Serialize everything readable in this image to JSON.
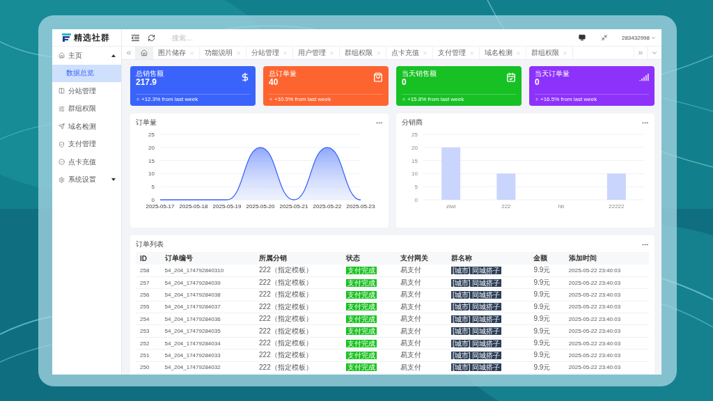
{
  "brand": {
    "name": "精选社群"
  },
  "header": {
    "search": {
      "placeholder": "搜索..."
    },
    "user": "283432998"
  },
  "sidebar": {
    "items": [
      {
        "label": "主页",
        "selected": false,
        "expanded": true,
        "children": [
          {
            "label": "数据总览",
            "selected": true
          }
        ]
      },
      {
        "label": "分站管理",
        "selected": false
      },
      {
        "label": "群组权限",
        "selected": false
      },
      {
        "label": "域名检测",
        "selected": false
      },
      {
        "label": "支付管理",
        "selected": false
      },
      {
        "label": "点卡充值",
        "selected": false
      },
      {
        "label": "系统设置",
        "selected": false,
        "expanded": false
      }
    ]
  },
  "tabs": [
    {
      "kind": "home",
      "selected": true
    },
    {
      "kind": "page",
      "label": "图片储存",
      "selected": false
    },
    {
      "kind": "page",
      "label": "功能说明",
      "selected": false
    },
    {
      "kind": "page",
      "label": "分站管理",
      "selected": false
    },
    {
      "kind": "page",
      "label": "用户管理",
      "selected": false
    },
    {
      "kind": "page",
      "label": "群组权限",
      "selected": false
    },
    {
      "kind": "page",
      "label": "点卡充值",
      "selected": false
    },
    {
      "kind": "page",
      "label": "支付管理",
      "selected": false
    },
    {
      "kind": "page",
      "label": "域名检测",
      "selected": false
    },
    {
      "kind": "page",
      "label": "群组权限",
      "selected": false
    }
  ],
  "stats": [
    {
      "title": "总销售额",
      "value": "217.9",
      "trend": "+12.3% from last week",
      "color": "#3a63fb"
    },
    {
      "title": "总订单量",
      "value": "40",
      "trend": "+10.5% from last week",
      "color": "#fd6430"
    },
    {
      "title": "当天销售额",
      "value": "0",
      "trend": "+15.8% from last week",
      "color": "#17c124"
    },
    {
      "title": "当天订单量",
      "value": "0",
      "trend": "+16.5% from last week",
      "color": "#8d32fb"
    }
  ],
  "charts": [
    {
      "title": "订单量",
      "chart_data": {
        "type": "area",
        "categories": [
          "2025-05-17",
          "2025-05-18",
          "2025-05-19",
          "2025-05-20",
          "2025-05-21",
          "2025-05-22",
          "2025-05-23"
        ],
        "values": [
          0,
          0,
          0,
          20,
          0,
          20,
          0
        ],
        "grid": true,
        "ylim": [
          0,
          25
        ],
        "yticks": [
          0,
          5,
          10,
          15,
          20,
          25
        ]
      }
    },
    {
      "title": "分销商",
      "chart_data": {
        "type": "bar",
        "categories": [
          "zlwl",
          "222",
          "hb",
          "22222"
        ],
        "values": [
          20,
          10,
          0,
          10
        ],
        "grid": true,
        "ylim": [
          0,
          25
        ],
        "yticks": [
          0,
          5,
          10,
          15,
          20,
          25
        ]
      }
    }
  ],
  "orders": {
    "title": "订单列表",
    "columns": [
      "ID",
      "订单编号",
      "所属分销",
      "状态",
      "支付网关",
      "群名称",
      "金额",
      "添加时间"
    ],
    "rows": [
      [
        "258",
        "54_204_174792840310",
        "222（指定模板）",
        "支付完成",
        "易支付",
        "[城市] 同城搭子",
        "9.9元",
        "2025-05-22 23:40:03"
      ],
      [
        "257",
        "54_204_17479284039",
        "222（指定模板）",
        "支付完成",
        "易支付",
        "[城市] 同城搭子",
        "9.9元",
        "2025-05-22 23:40:03"
      ],
      [
        "256",
        "54_204_17479284038",
        "222（指定模板）",
        "支付完成",
        "易支付",
        "[城市] 同城搭子",
        "9.9元",
        "2025-05-22 23:40:03"
      ],
      [
        "255",
        "54_204_17479284037",
        "222（指定模板）",
        "支付完成",
        "易支付",
        "[城市] 同城搭子",
        "9.9元",
        "2025-05-22 23:40:03"
      ],
      [
        "254",
        "54_204_17479284036",
        "222（指定模板）",
        "支付完成",
        "易支付",
        "[城市] 同城搭子",
        "9.9元",
        "2025-05-22 23:40:03"
      ],
      [
        "253",
        "54_204_17479284035",
        "222（指定模板）",
        "支付完成",
        "易支付",
        "[城市] 同城搭子",
        "9.9元",
        "2025-05-22 23:40:03"
      ],
      [
        "252",
        "54_204_17479284034",
        "222（指定模板）",
        "支付完成",
        "易支付",
        "[城市] 同城搭子",
        "9.9元",
        "2025-05-22 23:40:03"
      ],
      [
        "251",
        "54_204_17479284033",
        "222（指定模板）",
        "支付完成",
        "易支付",
        "[城市] 同城搭子",
        "9.9元",
        "2025-05-22 23:40:03"
      ],
      [
        "250",
        "54_204_17479284032",
        "222（指定模板）",
        "支付完成",
        "易支付",
        "[城市] 同城搭子",
        "9.9元",
        "2025-05-22 23:40:03"
      ]
    ]
  }
}
